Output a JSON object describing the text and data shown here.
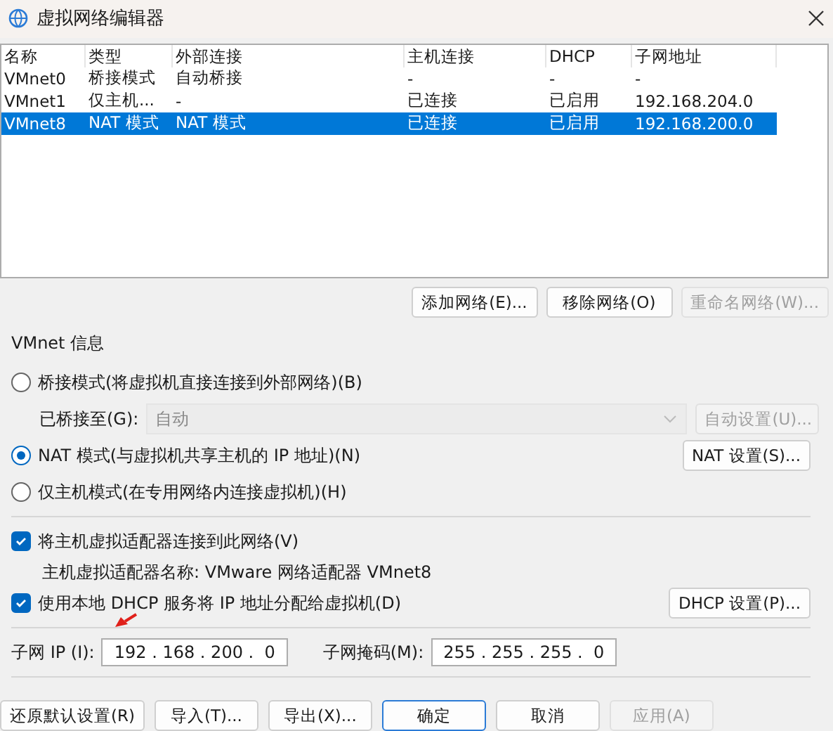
{
  "window": {
    "title": "虚拟网络编辑器"
  },
  "table": {
    "columns": [
      "名称",
      "类型",
      "外部连接",
      "主机连接",
      "DHCP",
      "子网地址"
    ],
    "rows": [
      {
        "cells": [
          "VMnet0",
          "桥接模式",
          "自动桥接",
          "-",
          "-",
          "-"
        ],
        "selected": false
      },
      {
        "cells": [
          "VMnet1",
          "仅主机...",
          "-",
          "已连接",
          "已启用",
          "192.168.204.0"
        ],
        "selected": false
      },
      {
        "cells": [
          "VMnet8",
          "NAT 模式",
          "NAT 模式",
          "已连接",
          "已启用",
          "192.168.200.0"
        ],
        "selected": true
      }
    ]
  },
  "network_buttons": [
    {
      "label": "添加网络(E)...",
      "disabled": false
    },
    {
      "label": "移除网络(O)",
      "disabled": false
    },
    {
      "label": "重命名网络(W)...",
      "disabled": true
    }
  ],
  "vmnet_info": {
    "title": "VMnet 信息",
    "modes": [
      {
        "label": "桥接模式(将虚拟机直接连接到外部网络)(B)",
        "selected": false
      },
      {
        "label": "NAT 模式(与虚拟机共享主机的 IP 地址)(N)",
        "selected": true
      },
      {
        "label": "仅主机模式(在专用网络内连接虚拟机)(H)",
        "selected": false
      }
    ],
    "bridged_to": {
      "label": "已桥接至(G):",
      "value": "自动",
      "disabled": true
    },
    "auto_settings_button": {
      "label": "自动设置(U)...",
      "disabled": true
    },
    "nat_settings_button": {
      "label": "NAT 设置(S)...",
      "disabled": false
    },
    "host_adapter": {
      "label": "将主机虚拟适配器连接到此网络(V)",
      "checked": true
    },
    "adapter_name": "主机虚拟适配器名称: VMware 网络适配器 VMnet8",
    "dhcp": {
      "label": "使用本地 DHCP 服务将 IP 地址分配给虚拟机(D)",
      "checked": true
    },
    "dhcp_settings_button": {
      "label": "DHCP 设置(P)...",
      "disabled": false
    },
    "subnet_ip": {
      "label": "子网 IP (I):",
      "value": "192 . 168 . 200 .  0"
    },
    "subnet_mask": {
      "label": "子网掩码(M):",
      "value": "255 . 255 . 255 .  0"
    }
  },
  "footer_buttons": [
    {
      "label": "还原默认设置(R)",
      "disabled": false,
      "default": false
    },
    {
      "label": "导入(T)...",
      "disabled": false,
      "default": false
    },
    {
      "label": "导出(X)...",
      "disabled": false,
      "default": false
    },
    {
      "label": "确定",
      "disabled": false,
      "default": true
    },
    {
      "label": "取消",
      "disabled": false,
      "default": false
    },
    {
      "label": "应用(A)",
      "disabled": true,
      "default": false
    }
  ]
}
